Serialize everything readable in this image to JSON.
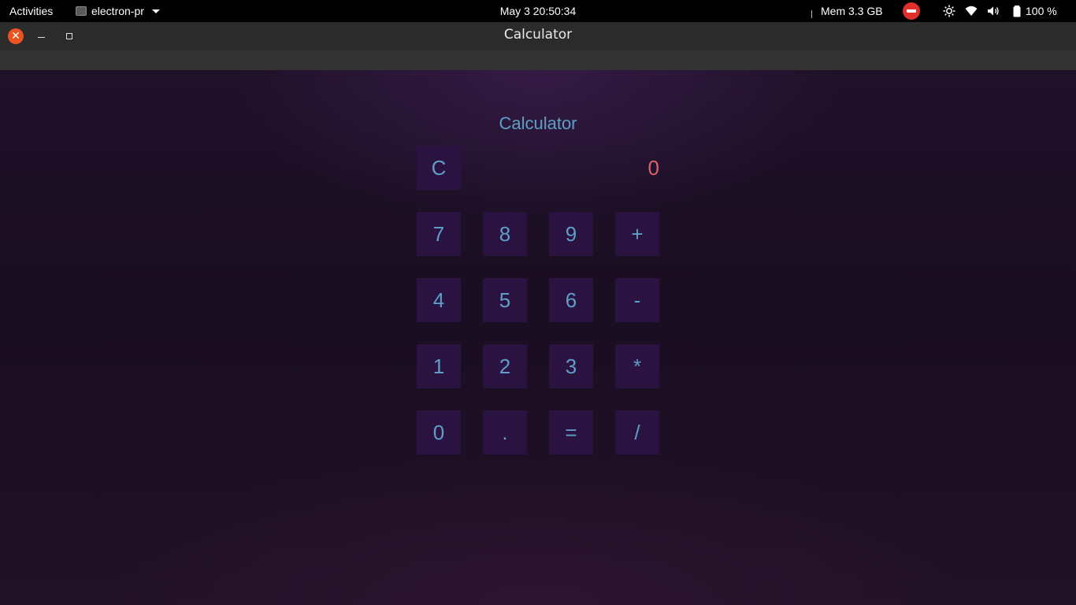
{
  "topbar": {
    "activities": "Activities",
    "app_menu": "electron-pr",
    "clock": "May 3  20:50:34",
    "memory": "Mem 3.3 GB",
    "battery": "100 %",
    "icons": [
      "stop-indicator-icon",
      "brightness-icon",
      "wifi-icon",
      "volume-icon",
      "battery-icon"
    ]
  },
  "window": {
    "title": "Calculator",
    "close_glyph": "✕",
    "accent": "#e95420"
  },
  "calculator": {
    "heading": "Calculator",
    "clear_label": "C",
    "display_value": "0",
    "keys": [
      [
        "7",
        "8",
        "9",
        "+"
      ],
      [
        "4",
        "5",
        "6",
        "-"
      ],
      [
        "1",
        "2",
        "3",
        "*"
      ],
      [
        "0",
        ".",
        "=",
        "/"
      ]
    ],
    "colors": {
      "key_bg": "#2a1340",
      "key_text": "#5f9ec7",
      "display_text": "#d9626c"
    }
  }
}
